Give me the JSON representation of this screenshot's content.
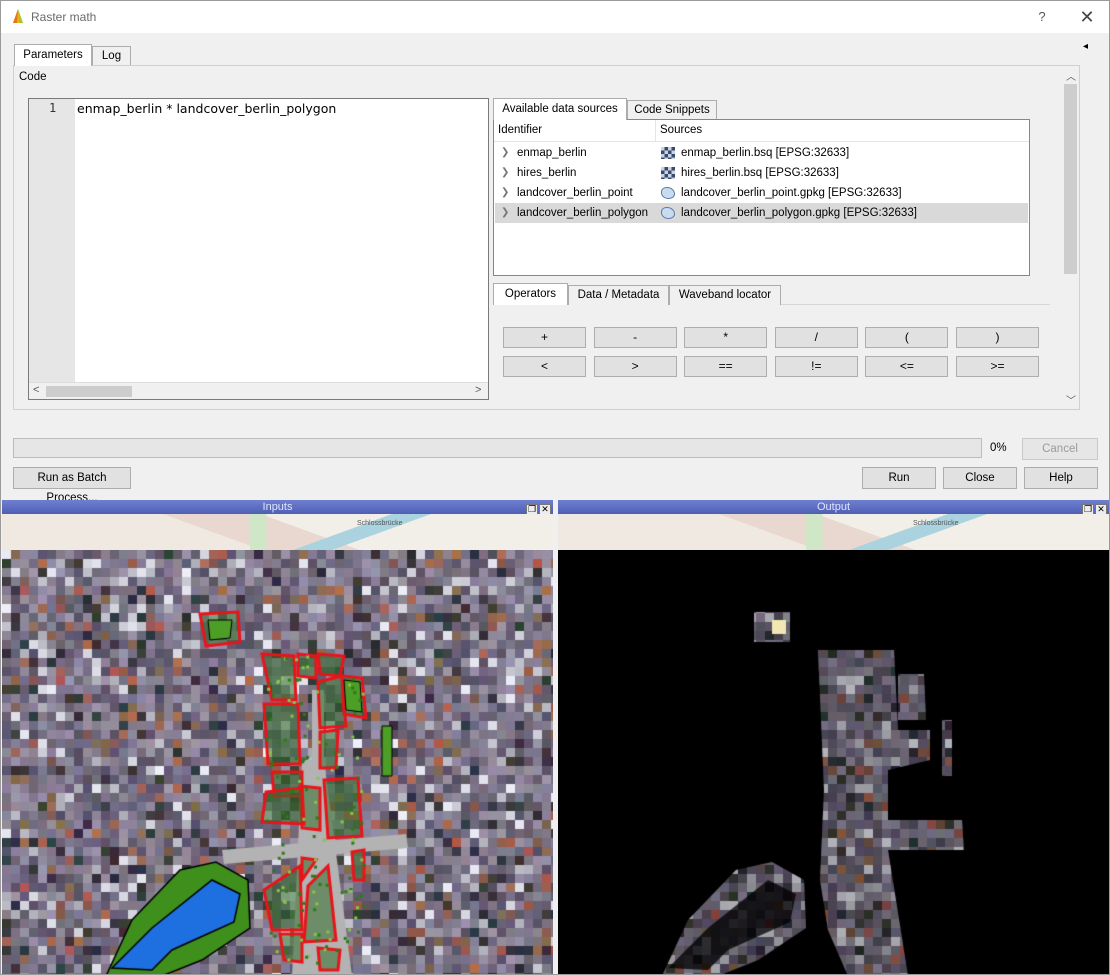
{
  "window": {
    "title": "Raster math",
    "help_label": "?",
    "close_label": "✕",
    "collapse_label": "◂"
  },
  "tabs": [
    {
      "label": "Parameters"
    },
    {
      "label": "Log"
    }
  ],
  "code": {
    "section_label": "Code",
    "line_number": "1",
    "text": "enmap_berlin * landcover_berlin_polygon"
  },
  "sources_tabs": [
    {
      "label": "Available data sources"
    },
    {
      "label": "Code Snippets"
    }
  ],
  "sources_headers": {
    "identifier": "Identifier",
    "sources": "Sources"
  },
  "sources": [
    {
      "identifier": "enmap_berlin",
      "source": "enmap_berlin.bsq [EPSG:32633]",
      "kind": "raster"
    },
    {
      "identifier": "hires_berlin",
      "source": "hires_berlin.bsq [EPSG:32633]",
      "kind": "raster"
    },
    {
      "identifier": "landcover_berlin_point",
      "source": "landcover_berlin_point.gpkg [EPSG:32633]",
      "kind": "vector"
    },
    {
      "identifier": "landcover_berlin_polygon",
      "source": "landcover_berlin_polygon.gpkg [EPSG:32633]",
      "kind": "vector",
      "selected": true
    }
  ],
  "op_tabs": [
    {
      "label": "Operators"
    },
    {
      "label": "Data / Metadata"
    },
    {
      "label": "Waveband locator"
    }
  ],
  "operators": [
    "+",
    "-",
    "*",
    "/",
    "(",
    ")",
    "<",
    ">",
    "==",
    "!=",
    "<=",
    ">="
  ],
  "progress": {
    "value": 0,
    "text": "0%"
  },
  "buttons": {
    "batch": "Run as Batch Process...",
    "cancel": "Cancel",
    "run": "Run",
    "close": "Close",
    "help": "Help"
  },
  "docks": {
    "inputs_title": "Inputs",
    "output_title": "Output",
    "map_labels": [
      "Schlossbrücke"
    ]
  },
  "colors": {
    "dock_title": "#5a6bc0",
    "polygon_outline": "#e8141b",
    "vegetation": "#3f8f1c",
    "water": "#1e6fe0"
  }
}
